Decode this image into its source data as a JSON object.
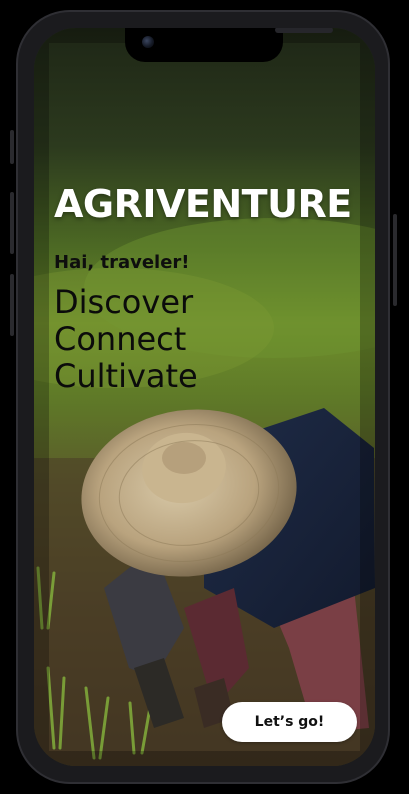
{
  "app": {
    "title": "AGRIVENTURE",
    "greeting": "Hai, traveler!",
    "tagline": [
      "Discover",
      "Connect",
      "Cultivate"
    ]
  },
  "cta": {
    "label": "Let’s go!"
  },
  "hero_image": {
    "subject": "farmer-planting-rice"
  },
  "colors": {
    "title_text": "#ffffff",
    "tagline_text": "#0b0b0b",
    "button_bg": "#ffffff",
    "button_text": "#111111",
    "frame": "#1b1b1e"
  }
}
